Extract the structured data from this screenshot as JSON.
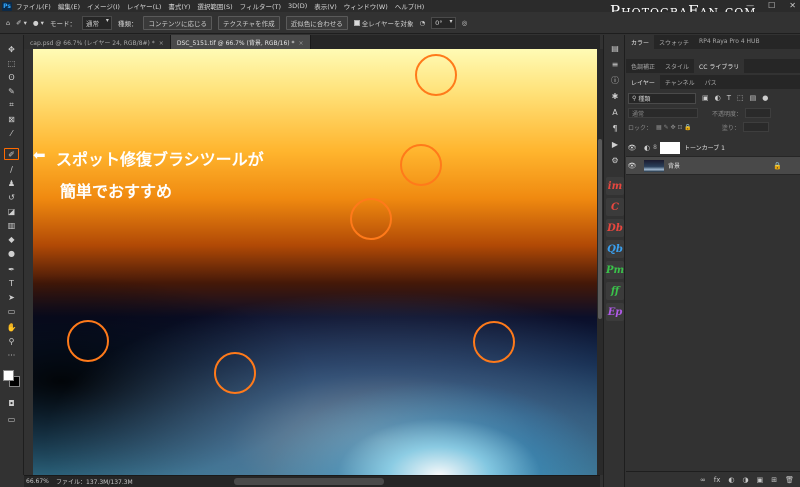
{
  "app": {
    "logo": "Ps"
  },
  "menu": [
    "ファイル(F)",
    "編集(E)",
    "イメージ(I)",
    "レイヤー(L)",
    "書式(Y)",
    "選択範囲(S)",
    "フィルター(T)",
    "3D(D)",
    "表示(V)",
    "ウィンドウ(W)",
    "ヘルプ(H)"
  ],
  "watermark": "PhotograFan.com",
  "window_controls": {
    "minimize": "—",
    "maximize": "☐",
    "close": "✕"
  },
  "options_bar": {
    "mode_label": "モード：",
    "mode_value": "通常",
    "type_label": "種類：",
    "type_options": [
      "コンテンツに応じる",
      "テクスチャを作成",
      "近似色に合わせる"
    ],
    "sample_all_layers": "全レイヤーを対象",
    "angle_value": "0°"
  },
  "tabs": [
    {
      "label": "cap.psd @ 66.7% (レイヤー 24, RGB/8#) *",
      "active": false
    },
    {
      "label": "DSC_5151.tif @ 66.7% (背景, RGB/16) *",
      "active": true
    }
  ],
  "tools": [
    {
      "name": "move-tool",
      "glyph": "✥"
    },
    {
      "name": "marquee-tool",
      "glyph": "⬚"
    },
    {
      "name": "lasso-tool",
      "glyph": "ʘ"
    },
    {
      "name": "quick-select-tool",
      "glyph": "✎"
    },
    {
      "name": "crop-tool",
      "glyph": "⌗"
    },
    {
      "name": "frame-tool",
      "glyph": "⊠"
    },
    {
      "name": "eyedropper-tool",
      "glyph": "⁄"
    },
    {
      "name": "spot-healing-brush-tool",
      "glyph": "✐"
    },
    {
      "name": "brush-tool",
      "glyph": "∕"
    },
    {
      "name": "clone-stamp-tool",
      "glyph": "♟"
    },
    {
      "name": "history-brush-tool",
      "glyph": "↺"
    },
    {
      "name": "eraser-tool",
      "glyph": "◪"
    },
    {
      "name": "gradient-tool",
      "glyph": "▥"
    },
    {
      "name": "blur-tool",
      "glyph": "◆"
    },
    {
      "name": "dodge-tool",
      "glyph": "●"
    },
    {
      "name": "pen-tool",
      "glyph": "✒"
    },
    {
      "name": "type-tool",
      "glyph": "T"
    },
    {
      "name": "path-select-tool",
      "glyph": "➤"
    },
    {
      "name": "shape-tool",
      "glyph": "▭"
    },
    {
      "name": "hand-tool",
      "glyph": "✋"
    },
    {
      "name": "zoom-tool",
      "glyph": "⚲"
    },
    {
      "name": "edit-toolbar",
      "glyph": "···"
    }
  ],
  "annotation": {
    "arrow": "⬅",
    "line1": "スポット修復ブラシツールが",
    "line2": "簡単でおすすめ"
  },
  "status": {
    "zoom": "66.67%",
    "file": "ファイル：137.3M/137.3M"
  },
  "plugins": [
    {
      "label": "im",
      "color": "#e8473f"
    },
    {
      "label": "C",
      "color": "#e8473f"
    },
    {
      "label": "Db",
      "color": "#e8473f"
    },
    {
      "label": "Qb",
      "color": "#3aa0f0"
    },
    {
      "label": "Pm",
      "color": "#3ac24a"
    },
    {
      "label": "ff",
      "color": "#3ac24a"
    },
    {
      "label": "Ep",
      "color": "#b05ae8"
    }
  ],
  "panel_tabs_top": [
    {
      "label": "カラー",
      "active": true
    },
    {
      "label": "スウォッチ",
      "active": false
    },
    {
      "label": "RP4 Raya Pro 4 HUB",
      "active": false
    }
  ],
  "panel_tabs_mid": [
    {
      "label": "色調補正",
      "active": false
    },
    {
      "label": "スタイル",
      "active": false
    },
    {
      "label": "CC ライブラリ",
      "active": true
    }
  ],
  "layers_panel": {
    "tabs": [
      {
        "label": "レイヤー",
        "active": true
      },
      {
        "label": "チャンネル",
        "active": false
      },
      {
        "label": "パス",
        "active": false
      }
    ],
    "filter_label": "種類",
    "blend_mode": "通常",
    "opacity_label": "不透明度：",
    "lock_label": "ロック：",
    "fill_label": "塗り：",
    "layers": [
      {
        "name": "トーンカーブ 1",
        "selected": false,
        "locked": false
      },
      {
        "name": "背景",
        "selected": true,
        "locked": true
      }
    ],
    "footer_icons": [
      "∞",
      "fx",
      "◐",
      "◑",
      "▣",
      "⊞",
      "🗑"
    ]
  }
}
